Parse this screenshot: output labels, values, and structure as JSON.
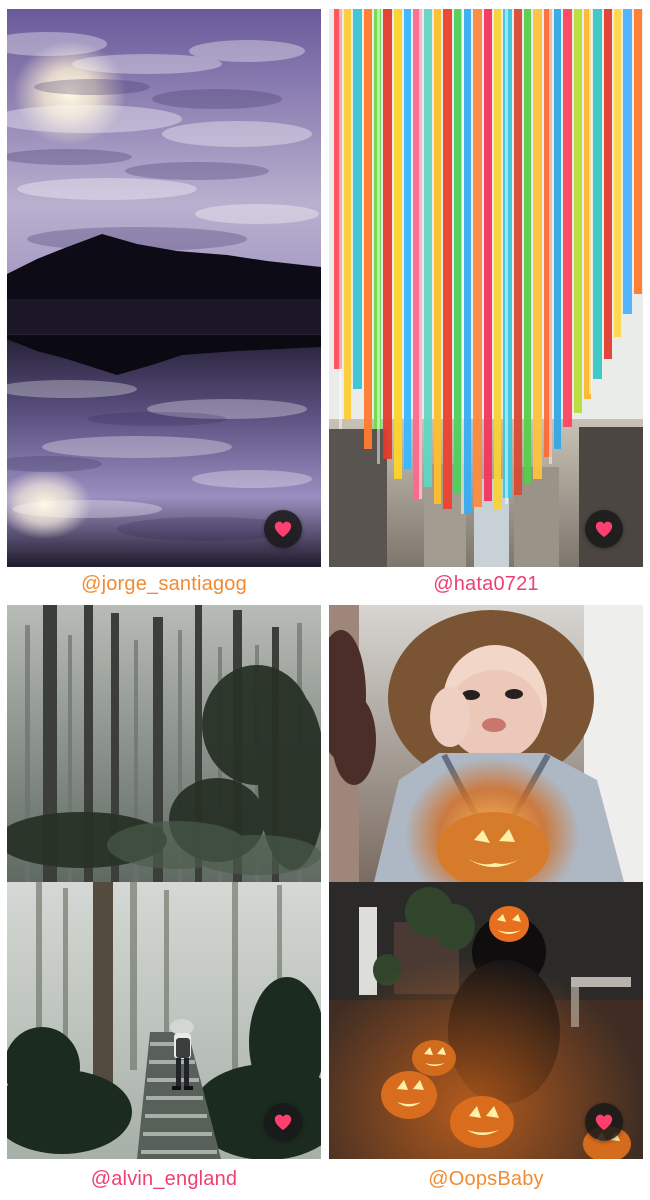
{
  "cards": [
    {
      "username": "@jorge_santiagog",
      "username_color": "#f28a32",
      "photos": [
        "cloudy lake reflection"
      ],
      "action_icon": "heart-icon"
    },
    {
      "username": "@hata0721",
      "username_color": "#ef3f6f",
      "photos": [
        "colorful ribbon installation"
      ],
      "action_icon": "heart-icon"
    },
    {
      "username": "@alvin_england",
      "username_color": "#ef3f6f",
      "photos": [
        "misty forest",
        "forest stairs with hiker"
      ],
      "action_icon": "heart-icon"
    },
    {
      "username": "@OopsBaby",
      "username_color": "#f28a32",
      "photos": [
        "girl with pumpkin",
        "jack-o-lanterns at night"
      ],
      "action_icon": "heart-icon"
    }
  ],
  "colors": {
    "background": "#ffffff",
    "heart": "#ff3f6f",
    "button": "#191919"
  }
}
